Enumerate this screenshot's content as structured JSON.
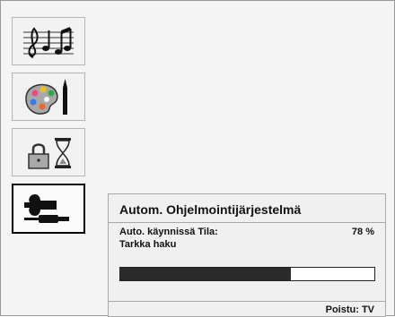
{
  "sidebar": {
    "items": [
      {
        "icon": "sound-music-icon"
      },
      {
        "icon": "picture-palette-icon"
      },
      {
        "icon": "lock-timer-icon"
      },
      {
        "icon": "setup-wrench-icon",
        "selected": true
      }
    ]
  },
  "dialog": {
    "title": "Autom. Ohjelmointijärjestelmä",
    "status_label": "Auto. käynnissä Tila:",
    "status_percent": "78 %",
    "search_mode": "Tarkka haku",
    "progress": 0.67,
    "footer_hint": "Poistu: TV"
  }
}
